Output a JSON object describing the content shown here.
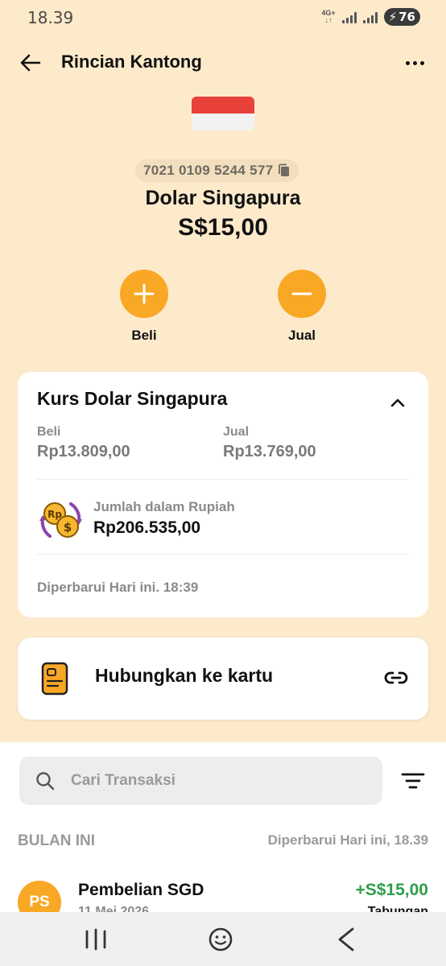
{
  "status_bar": {
    "time": "18.39",
    "network_label": "4G+",
    "battery": "76"
  },
  "header": {
    "title": "Rincian Kantong"
  },
  "pocket": {
    "account_number": "7021 0109 5244 577",
    "name": "Dolar Singapura",
    "balance": "S$15,00"
  },
  "actions": {
    "buy_label": "Beli",
    "sell_label": "Jual"
  },
  "rate_card": {
    "title": "Kurs Dolar Singapura",
    "buy_label": "Beli",
    "buy_value": "Rp13.809,00",
    "sell_label": "Jual",
    "sell_value": "Rp13.769,00",
    "conversion_label": "Jumlah dalam Rupiah",
    "conversion_value": "Rp206.535,00",
    "updated": "Diperbarui Hari ini. 18:39"
  },
  "link_card": {
    "label": "Hubungkan ke kartu"
  },
  "transactions": {
    "search_placeholder": "Cari Transaksi",
    "section_label": "BULAN INI",
    "section_updated": "Diperbarui Hari ini, 18.39",
    "items": [
      {
        "initials": "PS",
        "title": "Pembelian SGD",
        "date": "11 Mei 2026",
        "amount": "+S$15,00",
        "category": "Tabungan"
      }
    ]
  },
  "icons": {
    "back": "arrow-left-icon",
    "more": "more-icon",
    "copy": "copy-icon",
    "plus": "plus-icon",
    "minus": "minus-icon",
    "chevron": "chevron-up-icon",
    "exchange": "currency-exchange-icon",
    "card": "card-icon",
    "link": "link-icon",
    "search": "search-icon",
    "filter": "filter-icon"
  },
  "colors": {
    "background": "#fdeacb",
    "accent": "#f9a825",
    "positive": "#2e9e4a"
  }
}
